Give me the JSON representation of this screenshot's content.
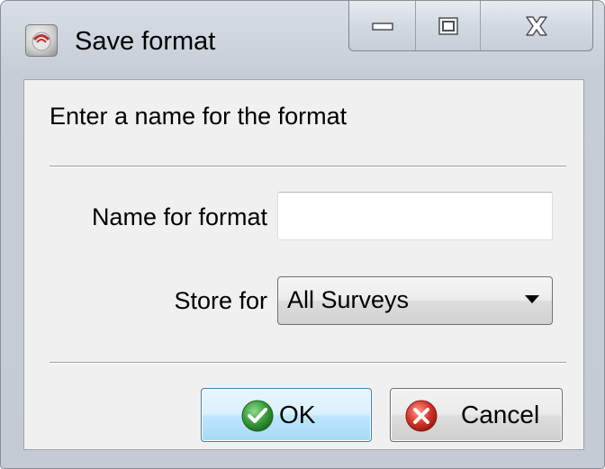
{
  "window": {
    "title": "Save format",
    "app_icon": "app-logo-icon",
    "caption_buttons": {
      "minimize_icon": "minimize-icon",
      "maximize_icon": "maximize-icon",
      "close_icon": "close-icon"
    }
  },
  "dialog": {
    "prompt": "Enter a name for the format",
    "name_field": {
      "label": "Name for format",
      "value": "",
      "placeholder": ""
    },
    "store_field": {
      "label": "Store for",
      "selected": "All Surveys"
    },
    "buttons": {
      "ok_label": "OK",
      "ok_icon": "check-icon",
      "cancel_label": "Cancel",
      "cancel_icon": "cancel-x-icon"
    }
  },
  "colors": {
    "ok_accent": "#3c7fb1",
    "check_green": "#3a9e3c",
    "cancel_red": "#d9352b"
  }
}
